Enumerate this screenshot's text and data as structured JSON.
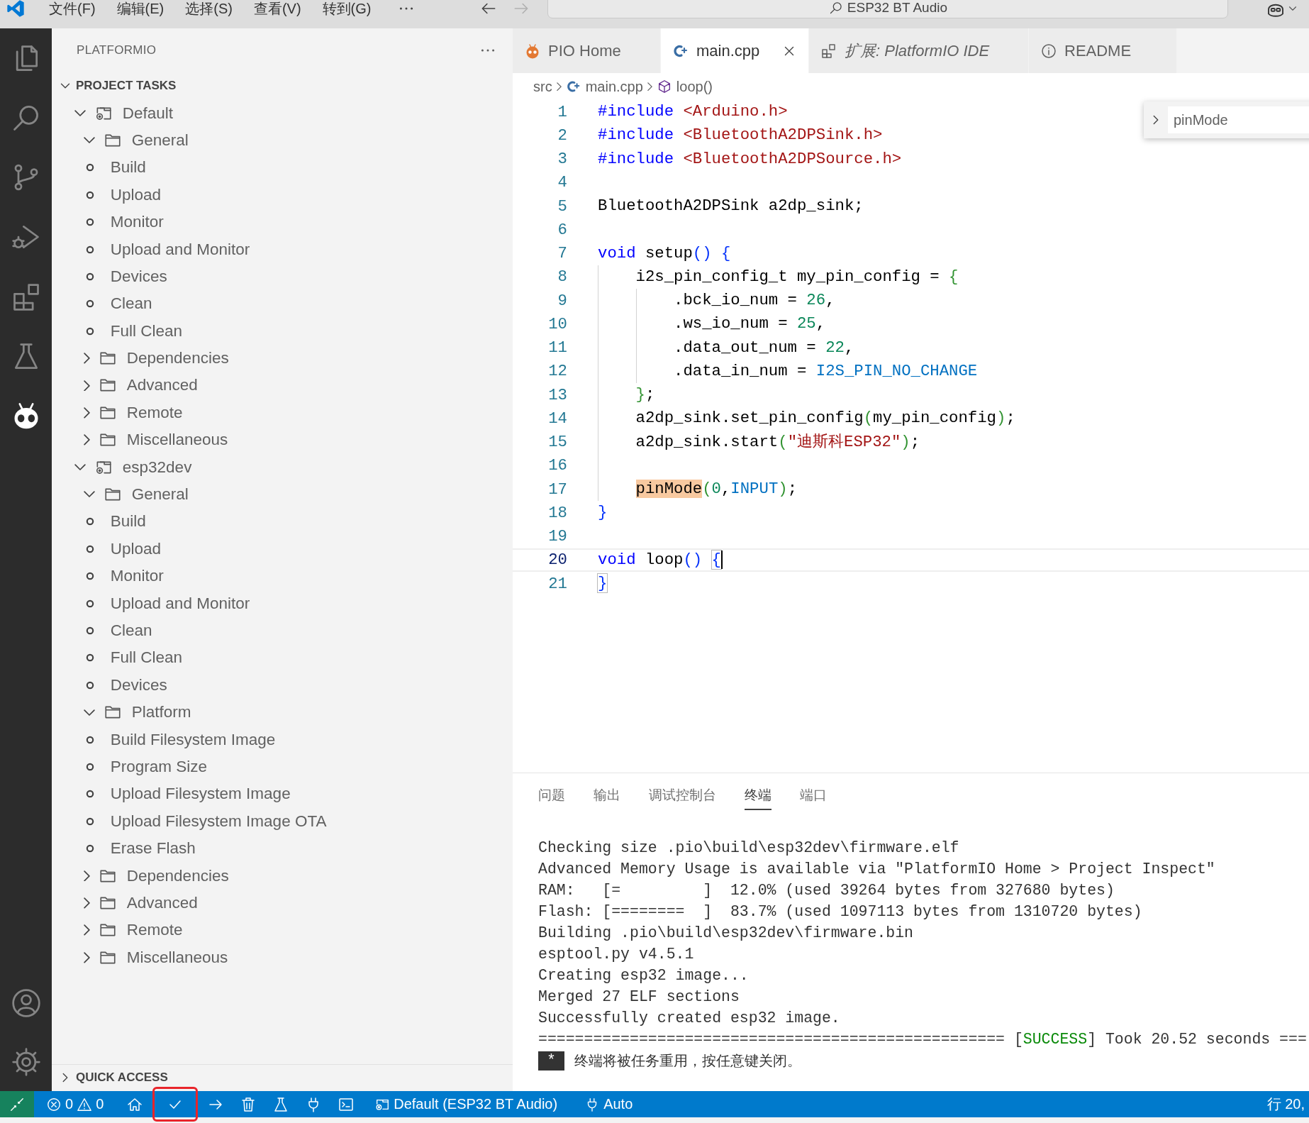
{
  "title_bar": {
    "menus": [
      "文件(F)",
      "编辑(E)",
      "选择(S)",
      "查看(V)",
      "转到(G)"
    ],
    "back_disabled": false,
    "forward_disabled": true,
    "search": "ESP32 BT Audio"
  },
  "activity_bar": {
    "items": [
      {
        "kind": "explorer",
        "selected": false
      },
      {
        "kind": "search",
        "selected": false
      },
      {
        "kind": "scm",
        "selected": false
      },
      {
        "kind": "debug",
        "selected": false
      },
      {
        "kind": "extensions",
        "selected": false
      },
      {
        "kind": "testing",
        "selected": false
      },
      {
        "kind": "platformio",
        "selected": true
      }
    ],
    "bottom": [
      {
        "kind": "accounts"
      },
      {
        "kind": "settings"
      }
    ]
  },
  "sidebar": {
    "title": "PLATFORMIO",
    "sections": [
      {
        "title": "PROJECT TASKS",
        "expanded": true,
        "children": [
          {
            "kind": "env",
            "label": "Default",
            "expanded": true,
            "children": [
              {
                "kind": "folder",
                "label": "General",
                "expanded": true,
                "children": [
                  {
                    "kind": "task",
                    "label": "Build"
                  },
                  {
                    "kind": "task",
                    "label": "Upload"
                  },
                  {
                    "kind": "task",
                    "label": "Monitor"
                  },
                  {
                    "kind": "task",
                    "label": "Upload and Monitor"
                  },
                  {
                    "kind": "task",
                    "label": "Devices"
                  },
                  {
                    "kind": "task",
                    "label": "Clean"
                  },
                  {
                    "kind": "task",
                    "label": "Full Clean"
                  }
                ]
              },
              {
                "kind": "folder",
                "label": "Dependencies",
                "expanded": false
              },
              {
                "kind": "folder",
                "label": "Advanced",
                "expanded": false
              },
              {
                "kind": "folder",
                "label": "Remote",
                "expanded": false
              },
              {
                "kind": "folder",
                "label": "Miscellaneous",
                "expanded": false
              }
            ]
          },
          {
            "kind": "env",
            "label": "esp32dev",
            "expanded": true,
            "children": [
              {
                "kind": "folder",
                "label": "General",
                "expanded": true,
                "children": [
                  {
                    "kind": "task",
                    "label": "Build"
                  },
                  {
                    "kind": "task",
                    "label": "Upload"
                  },
                  {
                    "kind": "task",
                    "label": "Monitor"
                  },
                  {
                    "kind": "task",
                    "label": "Upload and Monitor"
                  },
                  {
                    "kind": "task",
                    "label": "Clean"
                  },
                  {
                    "kind": "task",
                    "label": "Full Clean"
                  },
                  {
                    "kind": "task",
                    "label": "Devices"
                  }
                ]
              },
              {
                "kind": "folder",
                "label": "Platform",
                "expanded": true,
                "children": [
                  {
                    "kind": "task",
                    "label": "Build Filesystem Image"
                  },
                  {
                    "kind": "task",
                    "label": "Program Size"
                  },
                  {
                    "kind": "task",
                    "label": "Upload Filesystem Image"
                  },
                  {
                    "kind": "task",
                    "label": "Upload Filesystem Image OTA"
                  },
                  {
                    "kind": "task",
                    "label": "Erase Flash"
                  }
                ]
              },
              {
                "kind": "folder",
                "label": "Dependencies",
                "expanded": false
              },
              {
                "kind": "folder",
                "label": "Advanced",
                "expanded": false
              },
              {
                "kind": "folder",
                "label": "Remote",
                "expanded": false
              },
              {
                "kind": "folder",
                "label": "Miscellaneous",
                "expanded": false
              }
            ]
          }
        ]
      },
      {
        "title": "QUICK ACCESS",
        "expanded": false
      }
    ]
  },
  "editor": {
    "tabs": [
      {
        "label": "PIO Home",
        "kind": "pio",
        "selected": false,
        "preview": false
      },
      {
        "label": "main.cpp",
        "kind": "cpp",
        "selected": true,
        "preview": false
      },
      {
        "label": "扩展: PlatformIO IDE",
        "kind": "extension",
        "selected": false,
        "preview": true
      },
      {
        "label": "README",
        "kind": "info",
        "selected": false,
        "preview": false
      }
    ],
    "breadcrumb": [
      {
        "kind": "folder",
        "label": "src"
      },
      {
        "kind": "cpp",
        "label": "main.cpp"
      },
      {
        "kind": "function",
        "label": "loop()"
      }
    ],
    "find": {
      "value": "pinMode",
      "replace_expanded": false
    },
    "lines": [
      {
        "number": "1",
        "kind": "top",
        "current": false,
        "tokens": [
          {
            "kind": "keyword",
            "text": "#include "
          },
          {
            "kind": "string",
            "text": "<Arduino.h>"
          }
        ]
      },
      {
        "number": "2",
        "kind": "top",
        "current": false,
        "tokens": [
          {
            "kind": "keyword",
            "text": "#include "
          },
          {
            "kind": "string",
            "text": "<BluetoothA2DPSink.h>"
          }
        ]
      },
      {
        "number": "3",
        "kind": "top",
        "current": false,
        "tokens": [
          {
            "kind": "keyword",
            "text": "#include "
          },
          {
            "kind": "string",
            "text": "<BluetoothA2DPSource.h>"
          }
        ]
      },
      {
        "number": "4",
        "kind": "top",
        "current": false
      },
      {
        "number": "5",
        "kind": "top",
        "current": false,
        "tokens": [
          {
            "kind": "text",
            "text": "BluetoothA2DPSink a2dp_sink;"
          }
        ]
      },
      {
        "number": "6",
        "kind": "top",
        "current": false
      },
      {
        "number": "7",
        "kind": "top",
        "current": false,
        "tokens": [
          {
            "kind": "keyword",
            "text": "void"
          },
          {
            "kind": "text",
            "text": " setup"
          },
          {
            "kind": "bracket1",
            "text": "() "
          },
          {
            "kind": "bracket1",
            "text": "{"
          }
        ]
      },
      {
        "number": "8",
        "kind": "body",
        "current": false,
        "tokens": [
          {
            "kind": "text",
            "text": "i2s_pin_config_t my_pin_config = "
          },
          {
            "kind": "bracket2",
            "text": "{"
          }
        ]
      },
      {
        "number": "9",
        "kind": "inner",
        "current": false,
        "tokens": [
          {
            "kind": "text",
            "text": ".bck_io_num = "
          },
          {
            "kind": "number",
            "text": "26"
          },
          {
            "kind": "text",
            "text": ","
          }
        ]
      },
      {
        "number": "10",
        "kind": "inner",
        "current": false,
        "tokens": [
          {
            "kind": "text",
            "text": ".ws_io_num = "
          },
          {
            "kind": "number",
            "text": "25"
          },
          {
            "kind": "text",
            "text": ","
          }
        ]
      },
      {
        "number": "11",
        "kind": "inner",
        "current": false,
        "tokens": [
          {
            "kind": "text",
            "text": ".data_out_num = "
          },
          {
            "kind": "number",
            "text": "22"
          },
          {
            "kind": "text",
            "text": ","
          }
        ]
      },
      {
        "number": "12",
        "kind": "inner",
        "current": false,
        "tokens": [
          {
            "kind": "text",
            "text": ".data_in_num = "
          },
          {
            "kind": "constant",
            "text": "I2S_PIN_NO_CHANGE"
          }
        ]
      },
      {
        "number": "13",
        "kind": "body",
        "current": false,
        "tokens": [
          {
            "kind": "bracket2",
            "text": "}"
          },
          {
            "kind": "text",
            "text": ";"
          }
        ]
      },
      {
        "number": "14",
        "kind": "body",
        "current": false,
        "tokens": [
          {
            "kind": "text",
            "text": "a2dp_sink.set_pin_config"
          },
          {
            "kind": "bracket2",
            "text": "("
          },
          {
            "kind": "text",
            "text": "my_pin_config"
          },
          {
            "kind": "bracket2",
            "text": ")"
          },
          {
            "kind": "text",
            "text": ";"
          }
        ]
      },
      {
        "number": "15",
        "kind": "body",
        "current": false,
        "tokens": [
          {
            "kind": "text",
            "text": "a2dp_sink.start"
          },
          {
            "kind": "bracket2",
            "text": "("
          },
          {
            "kind": "string",
            "text": "\"迪斯科ESP32\""
          },
          {
            "kind": "bracket2",
            "text": ")"
          },
          {
            "kind": "text",
            "text": ";"
          }
        ]
      },
      {
        "number": "16",
        "kind": "body",
        "current": false
      },
      {
        "number": "17",
        "kind": "body",
        "current": false,
        "tokens": [
          {
            "kind": "text",
            "text": "pinMode",
            "highlighted": true
          },
          {
            "kind": "bracket2",
            "text": "("
          },
          {
            "kind": "number",
            "text": "0"
          },
          {
            "kind": "text",
            "text": ","
          },
          {
            "kind": "constant",
            "text": "INPUT"
          },
          {
            "kind": "bracket2",
            "text": ")"
          },
          {
            "kind": "text",
            "text": ";"
          }
        ]
      },
      {
        "number": "18",
        "kind": "top",
        "current": false,
        "tokens": [
          {
            "kind": "bracket1",
            "text": "}"
          }
        ]
      },
      {
        "number": "19",
        "kind": "top",
        "current": false
      },
      {
        "number": "20",
        "kind": "top",
        "current": true,
        "tokens": [
          {
            "kind": "keyword",
            "text": "void"
          },
          {
            "kind": "text",
            "text": " loop"
          },
          {
            "kind": "bracket1",
            "text": "() "
          },
          {
            "kind": "bracket1",
            "text": "{",
            "matched": true
          }
        ]
      },
      {
        "number": "21",
        "kind": "top",
        "current": false,
        "tokens": [
          {
            "kind": "bracket1",
            "text": "}",
            "matched": true
          }
        ]
      }
    ]
  },
  "panel": {
    "tabs": [
      {
        "label": "问题",
        "selected": false
      },
      {
        "label": "输出",
        "selected": false
      },
      {
        "label": "调试控制台",
        "selected": false
      },
      {
        "label": "终端",
        "selected": true
      },
      {
        "label": "端口",
        "selected": false
      }
    ],
    "terminal": {
      "lines": [
        {
          "text": "Checking size .pio\\build\\esp32dev\\firmware.elf"
        },
        {
          "text": "Advanced Memory Usage is available via \"PlatformIO Home > Project Inspect\""
        },
        {
          "text": "RAM:   [=         ]  12.0% (used 39264 bytes from 327680 bytes)"
        },
        {
          "text": "Flash: [========  ]  83.7% (used 1097113 bytes from 1310720 bytes)"
        },
        {
          "text": "Building .pio\\build\\esp32dev\\firmware.bin"
        },
        {
          "text": "esptool.py v4.5.1"
        },
        {
          "text": "Creating esp32 image..."
        },
        {
          "text": "Merged 27 ELF sections"
        },
        {
          "text": "Successfully created esp32 image."
        },
        {
          "parts": [
            {
              "kind": "text",
              "text": "=================================================== ["
            },
            {
              "kind": "success",
              "text": "SUCCESS"
            },
            {
              "kind": "text",
              "text": "] Took 20.52 seconds ==="
            }
          ]
        }
      ],
      "badge": "*",
      "message": "终端将被任务重用，按任意键关闭。"
    }
  },
  "status_bar": {
    "items": [
      {
        "kind": "remote"
      },
      {
        "kind": "problems",
        "errors": "0",
        "warnings": "0"
      },
      {
        "kind": "home",
        "outlined": false
      },
      {
        "kind": "build",
        "outlined": true
      },
      {
        "kind": "upload",
        "outlined": false
      },
      {
        "kind": "clean",
        "outlined": false
      },
      {
        "kind": "test",
        "outlined": false
      },
      {
        "kind": "monitor",
        "outlined": false
      },
      {
        "kind": "terminal",
        "outlined": false
      },
      {
        "kind": "env",
        "label": "Default (ESP32 BT Audio)"
      },
      {
        "kind": "port",
        "label": "Auto"
      }
    ],
    "position": "行 20,"
  }
}
